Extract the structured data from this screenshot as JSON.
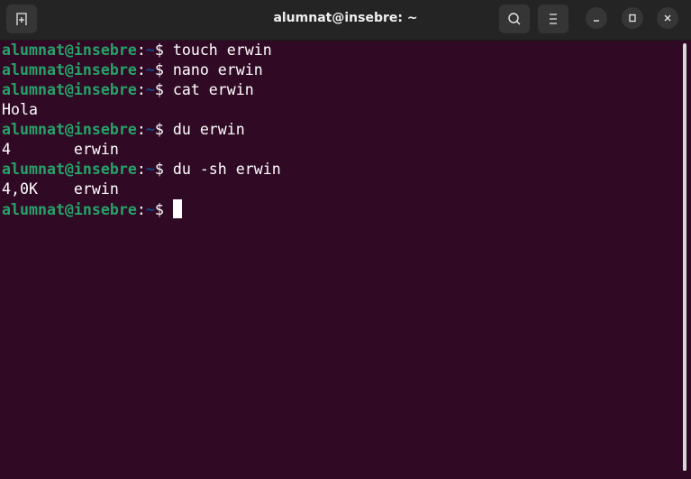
{
  "window": {
    "title": "alumnat@insebre: ~"
  },
  "titlebar": {
    "new_tab_icon": "new-tab-icon",
    "search_icon": "search-icon",
    "menu_icon": "hamburger-menu-icon",
    "minimize_icon": "minimize-icon",
    "maximize_icon": "maximize-icon",
    "close_icon": "close-icon"
  },
  "colors": {
    "background": "#300a24",
    "prompt_user": "#26a269",
    "prompt_path": "#12488b"
  },
  "prompt": {
    "user_host": "alumnat@insebre",
    "colon": ":",
    "path": "~",
    "symbol": "$ "
  },
  "lines": [
    {
      "type": "prompt",
      "command": "touch erwin"
    },
    {
      "type": "prompt",
      "command": "nano erwin"
    },
    {
      "type": "prompt",
      "command": "cat erwin"
    },
    {
      "type": "output",
      "text": "Hola"
    },
    {
      "type": "prompt",
      "command": "du erwin"
    },
    {
      "type": "output",
      "text": "4       erwin"
    },
    {
      "type": "prompt",
      "command": "du -sh erwin"
    },
    {
      "type": "output",
      "text": "4,0K    erwin"
    },
    {
      "type": "prompt",
      "command": ""
    }
  ]
}
